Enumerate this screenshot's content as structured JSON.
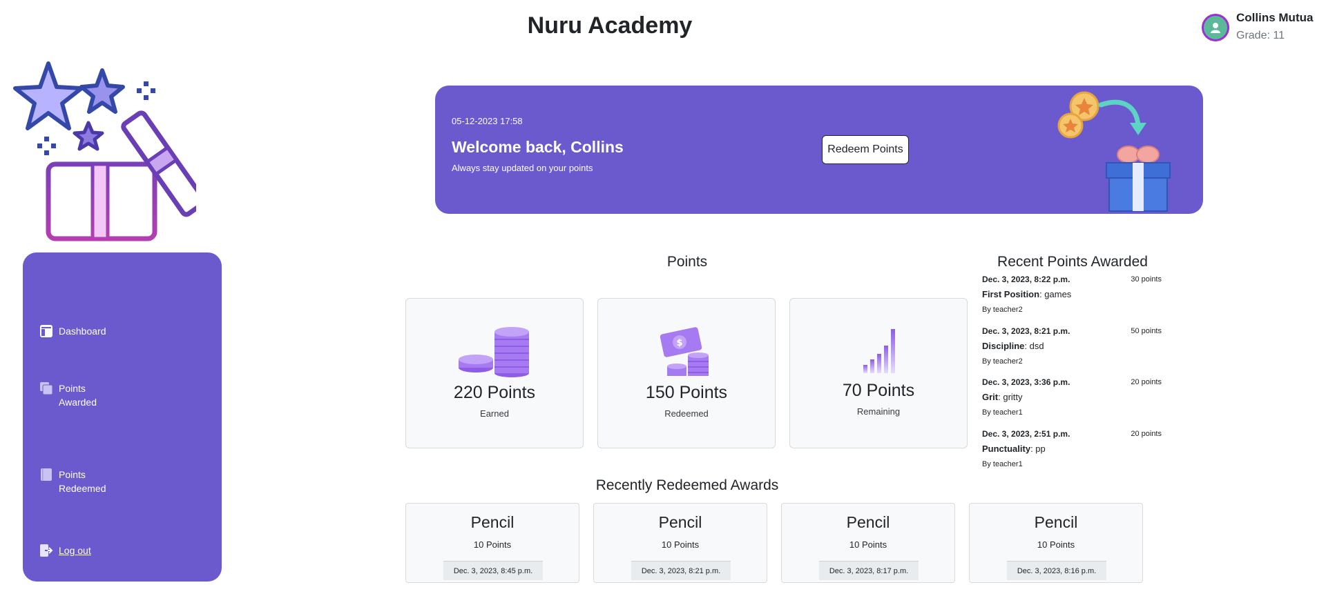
{
  "header": {
    "title": "Nuru Academy"
  },
  "user": {
    "name": "Collins Mutua",
    "grade": "Grade: 11",
    "avatar_icon": "user-icon"
  },
  "sidebar": {
    "items": [
      {
        "label": "Dashboard",
        "icon": "dashboard-icon"
      },
      {
        "label": "Points Awarded",
        "icon": "copy-icon"
      },
      {
        "label": "Points Redeemed",
        "icon": "book-icon"
      },
      {
        "label": "Log out",
        "icon": "logout-icon"
      }
    ]
  },
  "banner": {
    "datetime": "05-12-2023 17:58",
    "welcome": "Welcome back, Collins",
    "subtitle": "Always stay updated on your points",
    "button_label": "Redeem Points"
  },
  "points": {
    "title": "Points",
    "cards": [
      {
        "value": "220 Points",
        "label": "Earned",
        "icon": "coins-stack-icon"
      },
      {
        "value": "150 Points",
        "label": "Redeemed",
        "icon": "money-coins-icon"
      },
      {
        "value": "70 Points",
        "label": "Remaining",
        "icon": "bar-growth-icon"
      }
    ]
  },
  "recent": {
    "title": "Recent Points Awarded",
    "items": [
      {
        "date": "Dec. 3, 2023, 8:22 p.m.",
        "points": "30 points",
        "category": "First Position",
        "reason": ": games",
        "by": "By teacher2"
      },
      {
        "date": "Dec. 3, 2023, 8:21 p.m.",
        "points": "50 points",
        "category": "Discipline",
        "reason": ": dsd",
        "by": "By teacher2"
      },
      {
        "date": "Dec. 3, 2023, 3:36 p.m.",
        "points": "20 points",
        "category": "Grit",
        "reason": ": gritty",
        "by": "By teacher1"
      },
      {
        "date": "Dec. 3, 2023, 2:51 p.m.",
        "points": "20 points",
        "category": "Punctuality",
        "reason": ": pp",
        "by": "By teacher1"
      }
    ]
  },
  "redeemed": {
    "title": "Recently Redeemed Awards",
    "items": [
      {
        "name": "Pencil",
        "points": "10 Points",
        "date": "Dec. 3, 2023, 8:45 p.m."
      },
      {
        "name": "Pencil",
        "points": "10 Points",
        "date": "Dec. 3, 2023, 8:21 p.m."
      },
      {
        "name": "Pencil",
        "points": "10 Points",
        "date": "Dec. 3, 2023, 8:17 p.m."
      },
      {
        "name": "Pencil",
        "points": "10 Points",
        "date": "Dec. 3, 2023, 8:16 p.m."
      }
    ]
  },
  "colors": {
    "brand": "#6a5acd",
    "card_bg": "#f8f9fa",
    "avatar": "#5bb99a"
  }
}
